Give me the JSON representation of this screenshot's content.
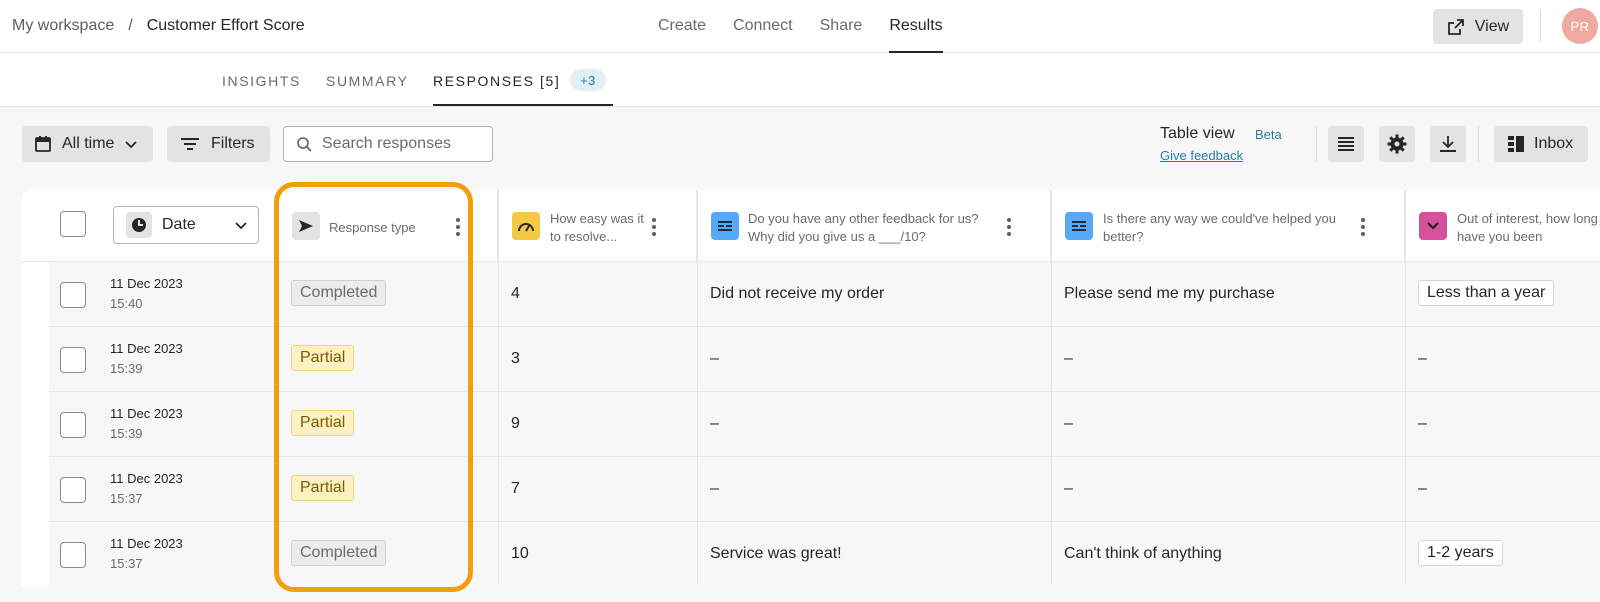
{
  "breadcrumb": {
    "workspace": "My workspace",
    "separator": "/",
    "form": "Customer Effort Score"
  },
  "main_nav": [
    "Create",
    "Connect",
    "Share",
    "Results"
  ],
  "main_nav_active": "Results",
  "header_actions": {
    "view_label": "View",
    "avatar_initials": "PR"
  },
  "sub_tabs": {
    "insights": "INSIGHTS",
    "summary": "SUMMARY",
    "responses": "RESPONSES [5]",
    "extra_badge": "+3"
  },
  "toolbar": {
    "date_range_label": "All time",
    "filters_label": "Filters",
    "search_placeholder": "Search responses",
    "table_view_label": "Table view",
    "table_view_badge": "Beta",
    "give_feedback": "Give feedback",
    "inbox_label": "Inbox"
  },
  "table": {
    "columns": {
      "date": "Date",
      "response_type": "Response type",
      "q1": "How easy was it to resolve...",
      "q2": "Do you have any other feedback for us? Why did you give us a ___/10?",
      "q3": "Is there any way we could've helped you better?",
      "q4": "Out of interest, how long have you been"
    },
    "rows": [
      {
        "date": "11 Dec 2023",
        "time": "15:40",
        "type": "Completed",
        "q1": "4",
        "q2": "Did not receive my order",
        "q3": "Please send me my purchase",
        "q4": "Less than a year"
      },
      {
        "date": "11 Dec 2023",
        "time": "15:39",
        "type": "Partial",
        "q1": "3",
        "q2": "–",
        "q3": "–",
        "q4": "–"
      },
      {
        "date": "11 Dec 2023",
        "time": "15:39",
        "type": "Partial",
        "q1": "9",
        "q2": "–",
        "q3": "–",
        "q4": "–"
      },
      {
        "date": "11 Dec 2023",
        "time": "15:37",
        "type": "Partial",
        "q1": "7",
        "q2": "–",
        "q3": "–",
        "q4": "–"
      },
      {
        "date": "11 Dec 2023",
        "time": "15:37",
        "type": "Completed",
        "q1": "10",
        "q2": "Service was great!",
        "q3": "Can't think of anything",
        "q4": "1-2 years"
      }
    ]
  },
  "colors": {
    "highlight": "#f59e0b",
    "partial_bg": "#fdf1c4",
    "completed_bg": "#ececec",
    "accent_link": "#2a7da8"
  },
  "icons": [
    "calendar-icon",
    "chevron-down-icon",
    "filter-icon",
    "search-icon",
    "external-link-icon",
    "rows-icon",
    "gear-icon",
    "download-icon",
    "inbox-grid-icon",
    "clock-icon",
    "send-icon",
    "gauge-icon",
    "text-lines-icon",
    "dropdown-icon",
    "kebab-icon"
  ]
}
